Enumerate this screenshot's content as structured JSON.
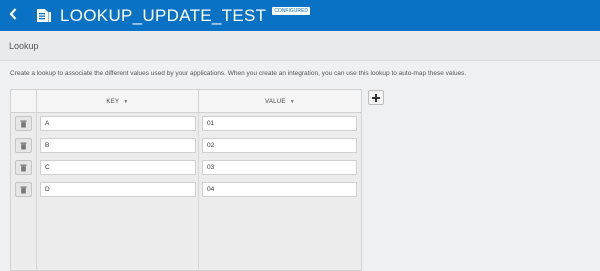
{
  "header": {
    "title": "LOOKUP_UPDATE_TEST",
    "badge": "CONFIGURED",
    "back_icon": "chevron-left-icon",
    "doc_icon": "lookup-document-icon",
    "bg_color": "#0a72c4"
  },
  "subheader": {
    "label": "Lookup"
  },
  "description": "Create a lookup to associate the different values used by your applications. When you create an integration, you can use this lookup to auto-map these values.",
  "table": {
    "columns": [
      {
        "label": "KEY",
        "sort_icon": "caret-down-icon"
      },
      {
        "label": "VALUE",
        "sort_icon": "caret-down-icon"
      }
    ],
    "rows": [
      {
        "key": "A",
        "value": "01"
      },
      {
        "key": "B",
        "value": "02"
      },
      {
        "key": "C",
        "value": "03"
      },
      {
        "key": "D",
        "value": "04"
      }
    ],
    "delete_icon": "trash-icon"
  },
  "add_button": {
    "icon": "plus-icon"
  }
}
